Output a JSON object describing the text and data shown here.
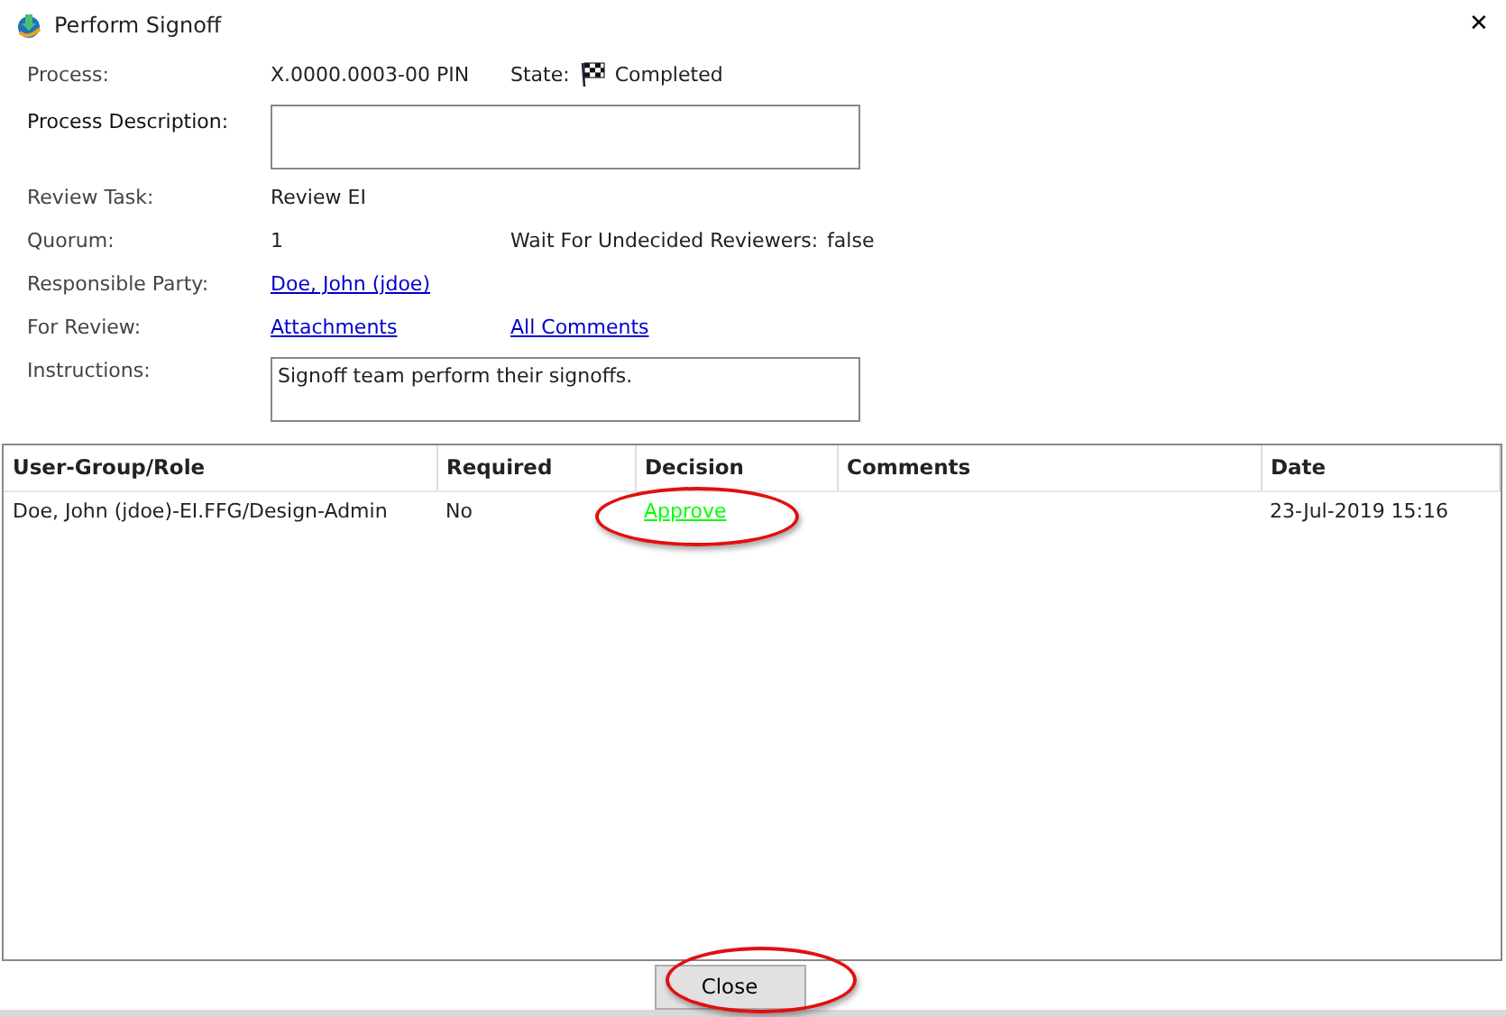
{
  "window": {
    "title": "Perform Signoff",
    "close": "✕"
  },
  "fields": {
    "process_label": "Process:",
    "process": "X.0000.0003-00 PIN",
    "state_label": "State:",
    "state": "Completed",
    "description_label": "Process Description:",
    "review_task_label": "Review Task:",
    "review_task": "Review EI",
    "quorum_label": "Quorum:",
    "quorum": "1",
    "wait_label": "Wait For Undecided Reviewers:",
    "wait": "false",
    "responsible_label": "Responsible Party:",
    "responsible": "Doe, John (jdoe)",
    "for_review_label": "For Review:",
    "attachments": "Attachments",
    "all_comments": "All Comments",
    "instructions_label": "Instructions:",
    "instructions": "Signoff team perform their signoffs."
  },
  "table": {
    "columns": [
      "User-Group/Role",
      "Required",
      "Decision",
      "Comments",
      "Date"
    ],
    "rows": [
      {
        "cells": [
          "Doe, John (jdoe)-EI.FFG/Design-Admin",
          "No",
          "Approve",
          null,
          "23-Jul-2019 15:16"
        ],
        "color": "#00ff00",
        "circled": true
      }
    ]
  },
  "buttons": [
    {
      "label": "Close",
      "circled": true
    }
  ]
}
